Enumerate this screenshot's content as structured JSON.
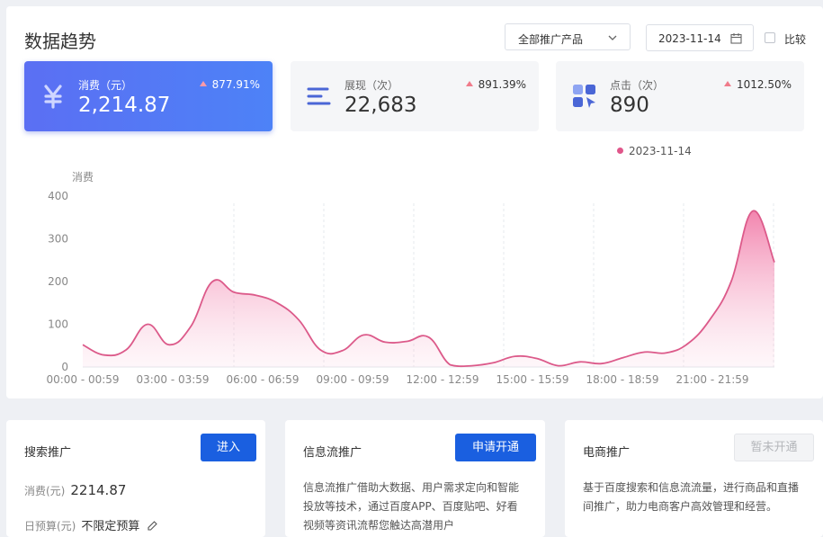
{
  "header": {
    "title": "数据趋势",
    "product_select": "全部推广产品",
    "date": "2023-11-14",
    "compare_label": "比较"
  },
  "metrics": [
    {
      "label": "消费（元）",
      "value": "2,214.87",
      "change": "877.91%",
      "icon": "yen-icon"
    },
    {
      "label": "展现（次）",
      "value": "22,683",
      "change": "891.39%",
      "icon": "list-lines-icon"
    },
    {
      "label": "点击（次）",
      "value": "890",
      "change": "1012.50%",
      "icon": "grid-click-icon"
    }
  ],
  "colors": {
    "accent": "#4d82f7",
    "line": "#dc5a8a",
    "up": "#f07b8a"
  },
  "chart_data": {
    "type": "area",
    "ylabel": "消费",
    "ylim": [
      0,
      400
    ],
    "yticks": [
      "0",
      "100",
      "200",
      "300",
      "400"
    ],
    "xticks": [
      "00:00 - 00:59",
      "03:00 - 03:59",
      "06:00 - 06:59",
      "09:00 - 09:59",
      "12:00 - 12:59",
      "15:00 - 15:59",
      "18:00 - 18:59",
      "21:00 - 21:59"
    ],
    "legend": "2023-11-14",
    "series": [
      {
        "name": "2023-11-14",
        "values": [
          52,
          28,
          40,
          100,
          52,
          95,
          200,
          175,
          168,
          150,
          110,
          40,
          38,
          75,
          58,
          60,
          70,
          5,
          3,
          10,
          25,
          20,
          3,
          12,
          8,
          22,
          35,
          33,
          55,
          110,
          200,
          365,
          245
        ]
      }
    ]
  },
  "bottom": {
    "search": {
      "title": "搜索推广",
      "button": "进入",
      "spend_label": "消费(元)",
      "spend_value": "2214.87",
      "budget_label": "日预算(元)",
      "budget_value": "不限定预算"
    },
    "feed": {
      "title": "信息流推广",
      "button": "申请开通",
      "desc1": "信息流推广借助大数据、用户需求定向和智能",
      "desc2": "投放等技术，通过百度APP、百度贴吧、好看",
      "desc3": "视频等资讯流帮您触达高潜用户"
    },
    "ecom": {
      "title": "电商推广",
      "button": "暂未开通",
      "desc1": "基于百度搜索和信息流流量，进行商品和直播",
      "desc2": "间推广，助力电商客户高效管理和经营。"
    }
  }
}
